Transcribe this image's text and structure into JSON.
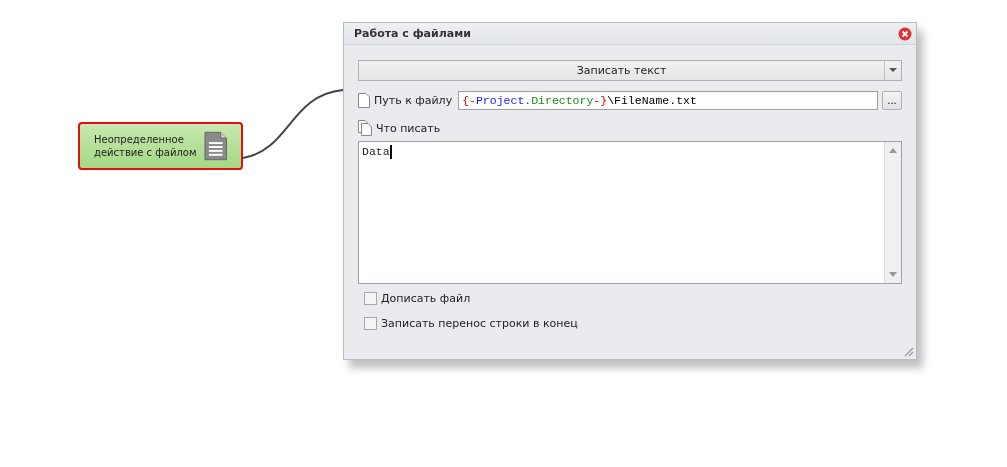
{
  "node": {
    "label": "Неопределенное действие с файлом",
    "selected": true
  },
  "dialog": {
    "title": "Работа с файлами",
    "action": {
      "value": "Записать текст"
    },
    "path": {
      "label": "Путь к файлу",
      "segments": [
        {
          "kind": "brace",
          "text": "{-"
        },
        {
          "kind": "project",
          "text": "Project."
        },
        {
          "kind": "directory",
          "text": "Directory"
        },
        {
          "kind": "brace",
          "text": "-}"
        },
        {
          "kind": "plain",
          "text": "\\FileName.txt"
        }
      ],
      "browse": "..."
    },
    "content": {
      "label": "Что писать",
      "value": "Data"
    },
    "options": [
      {
        "label": "Дописать файл",
        "checked": false
      },
      {
        "label": "Записать перенос строки в конец",
        "checked": false
      }
    ]
  }
}
